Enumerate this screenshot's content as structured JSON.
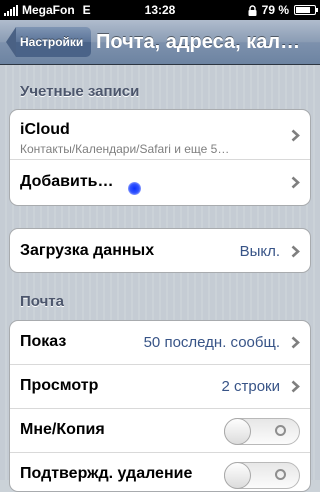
{
  "status_bar": {
    "carrier": "MegaFon",
    "network": "E",
    "time": "13:28",
    "battery_text": "79 %",
    "battery_level": 0.79,
    "icons": [
      "signal-icon",
      "lock-icon",
      "battery-icon"
    ]
  },
  "nav": {
    "back_label": "Настройки",
    "title": "Почта, адреса, кал…"
  },
  "accounts": {
    "header": "Учетные записи",
    "icloud_title": "iCloud",
    "icloud_subtitle": "Контакты/Календари/Safari и еще 5…",
    "add_title": "Добавить…"
  },
  "fetch": {
    "title": "Загрузка данных",
    "value": "Выкл."
  },
  "mail": {
    "header": "Почта",
    "show_title": "Показ",
    "show_value": "50 последн. сообщ.",
    "preview_title": "Просмотр",
    "preview_value": "2 строки",
    "cc_title": "Мне/Копия",
    "cc_on": false,
    "ask_delete_title": "Подтвержд. удаление",
    "ask_delete_on": false
  },
  "colors": {
    "navbar": "#6d84a2",
    "value_text": "#385487",
    "section_header": "#4c566c",
    "touch_indicator": "#0a2fff"
  }
}
